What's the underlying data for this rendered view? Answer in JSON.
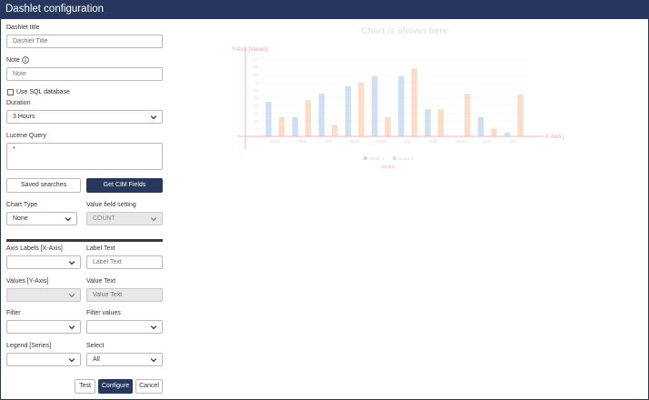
{
  "window": {
    "title": "Dashlet configuration"
  },
  "form": {
    "dashlet_title_label": "Dashlet title",
    "dashlet_title_placeholder": "Dashlet Title",
    "note_label": "Note",
    "note_placeholder": "Note",
    "use_sql_label": "Use SQL database",
    "duration_label": "Duration",
    "duration_value": "3 Hours",
    "lucene_label": "Lucene Query",
    "lucene_value": "*",
    "saved_searches_label": "Saved searches",
    "get_cim_label": "Get CIM Fields",
    "chart_type_label": "Chart Type",
    "chart_type_value": "None",
    "value_field_label": "Value field setting",
    "value_field_value": "COUNT",
    "axis_labels_label": "Axis Labels [X-Axis]",
    "axis_labels_value": "",
    "label_text_label": "Label Text",
    "label_text_placeholder": "Label Text",
    "values_label": "Values [Y-Axis]",
    "values_value": "",
    "value_text_label": "Value Text",
    "value_text_placeholder": "Value Text",
    "filter_label": "Filter",
    "filter_value": "",
    "filter_values_label": "Filter values",
    "filter_values_value": "",
    "legend_label": "Legend [Series]",
    "legend_value": "",
    "select_label": "Select",
    "select_value": "All",
    "test_label": "Test",
    "configure_label": "Configure",
    "cancel_label": "Cancel"
  },
  "colors": {
    "primary": "#27375e",
    "series1": "#a9c4e8",
    "series2": "#f6c29c",
    "axis": "#f08a8a"
  },
  "chart_data": {
    "type": "bar",
    "title": "Chart is shown here",
    "xlabel": "X-Axis [Labels]",
    "ylabel": "Y-Axis [Values]",
    "legend_title": "Series",
    "ylim": [
      0,
      100
    ],
    "yticks": [
      10,
      20,
      30,
      40,
      50,
      60,
      70,
      80,
      90,
      100
    ],
    "categories": [
      "Smbl",
      "Nhbg",
      "Jsfb",
      "Tavrn",
      "Frwgn",
      "Wgt",
      "Rgb",
      "Mtrkn",
      "Sntn",
      "Zmy"
    ],
    "series": [
      {
        "name": "Series 1",
        "values": [
          45,
          25,
          55,
          65,
          78,
          78,
          35,
          0,
          25,
          5
        ]
      },
      {
        "name": "Series 2",
        "values": [
          25,
          47,
          15,
          70,
          25,
          88,
          35,
          55,
          10,
          55
        ]
      }
    ]
  }
}
